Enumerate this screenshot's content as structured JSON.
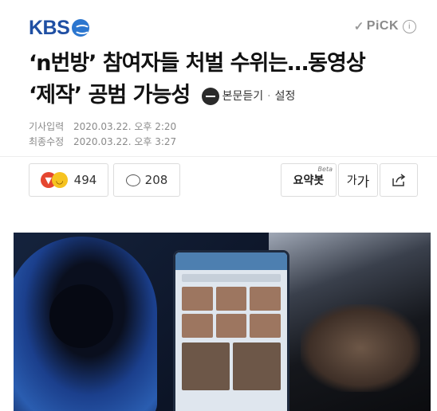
{
  "header": {
    "brand": "KBS",
    "pick_label": "PiCK",
    "pick_check": "✓",
    "info_icon": "i"
  },
  "article": {
    "title_line1": "‘n번방’ 참여자들 처벌 수위는…동영상",
    "title_line2": "‘제작’ 공범 가능성",
    "listen_label": "본문듣기",
    "settings_label": "설정",
    "separator": "·",
    "published_label": "기사입력",
    "published_value": "2020.03.22. 오후 2:20",
    "modified_label": "최종수정",
    "modified_value": "2020.03.22. 오후 3:27"
  },
  "actions": {
    "reaction_count": "494",
    "comment_count": "208",
    "summary_label": "요약봇",
    "summary_badge": "Beta",
    "font_small": "가",
    "font_big": "가"
  },
  "colors": {
    "brand_blue": "#1f4fa3",
    "angry": "#e5462f",
    "laugh": "#f6c320"
  }
}
